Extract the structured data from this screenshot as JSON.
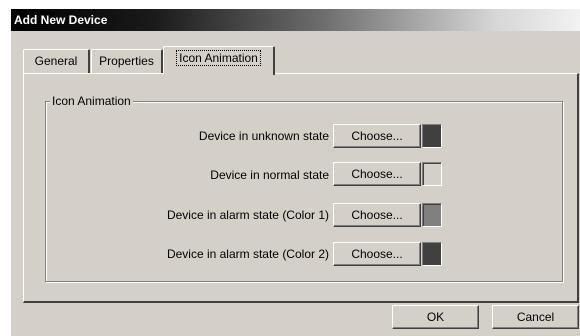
{
  "window": {
    "title": "Add New Device"
  },
  "tabs": [
    {
      "label": "General"
    },
    {
      "label": "Properties"
    },
    {
      "label": "Icon Animation"
    }
  ],
  "group": {
    "title": "Icon Animation"
  },
  "rows": [
    {
      "label": "Device in unknown state",
      "button": "Choose...",
      "color": "#404040"
    },
    {
      "label": "Device in normal state",
      "button": "Choose...",
      "color": "#d4d0c8"
    },
    {
      "label": "Device in alarm state (Color 1)",
      "button": "Choose...",
      "color": "#808080"
    },
    {
      "label": "Device in alarm state (Color 2)",
      "button": "Choose...",
      "color": "#404040"
    }
  ],
  "footer": {
    "ok_label": "OK",
    "cancel_label": "Cancel"
  }
}
